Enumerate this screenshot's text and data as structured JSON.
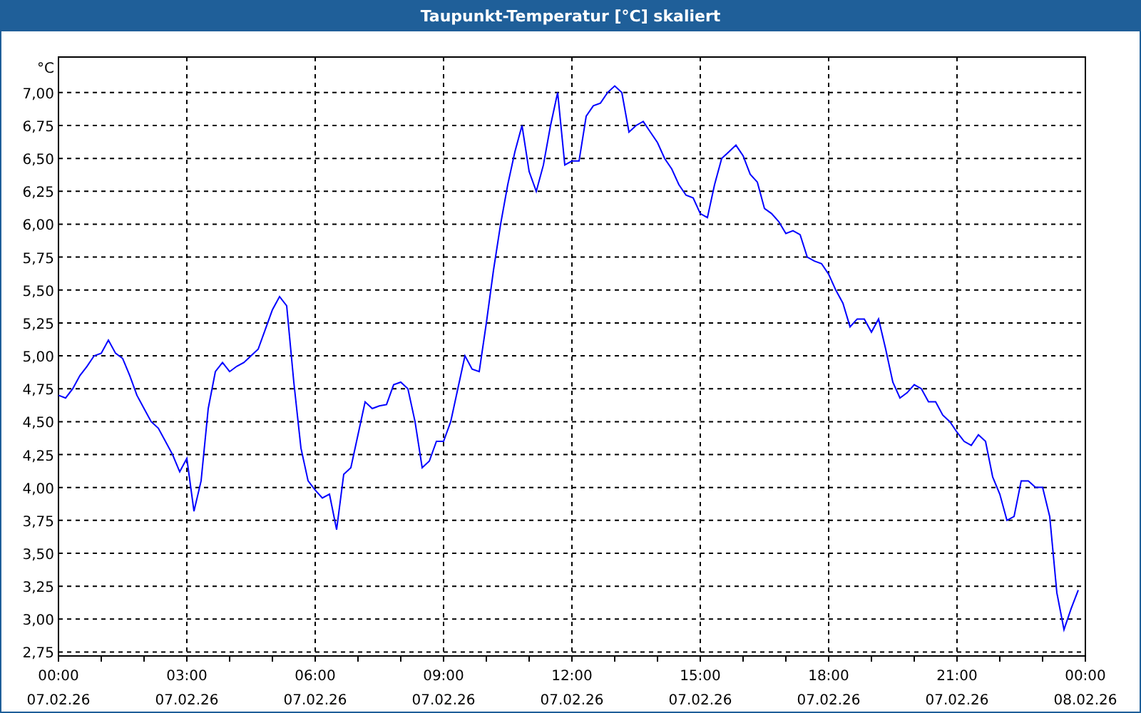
{
  "window": {
    "title": "Taupunkt-Temperatur [°C] skaliert"
  },
  "chart": {
    "chart_data": {
      "type": "line",
      "ylabel": "°C",
      "grid": true,
      "ylim": [
        2.72,
        7.27
      ],
      "categories": [
        "00:00 07.02.26",
        null,
        null,
        null,
        null,
        null,
        null,
        null,
        null,
        null,
        null,
        null,
        null,
        null,
        null,
        null,
        null,
        null,
        "03:00 07.02.26",
        null,
        null,
        null,
        null,
        null,
        null,
        null,
        null,
        null,
        null,
        null,
        null,
        null,
        null,
        null,
        null,
        null,
        "06:00 07.02.26",
        null,
        null,
        null,
        null,
        null,
        null,
        null,
        null,
        null,
        null,
        null,
        null,
        null,
        null,
        null,
        null,
        null,
        "09:00 07.02.26",
        null,
        null,
        null,
        null,
        null,
        null,
        null,
        null,
        null,
        null,
        null,
        null,
        null,
        null,
        null,
        null,
        null,
        "12:00 07.02.26",
        null,
        null,
        null,
        null,
        null,
        null,
        null,
        null,
        null,
        null,
        null,
        null,
        null,
        null,
        null,
        null,
        null,
        "15:00 07.02.26",
        null,
        null,
        null,
        null,
        null,
        null,
        null,
        null,
        null,
        null,
        null,
        null,
        null,
        null,
        null,
        null,
        null,
        "18:00 07.02.26",
        null,
        null,
        null,
        null,
        null,
        null,
        null,
        null,
        null,
        null,
        null,
        null,
        null,
        null,
        null,
        null,
        null,
        "21:00 07.02.26",
        null,
        null,
        null,
        null,
        null,
        null,
        null,
        null,
        null,
        null,
        null,
        null,
        null,
        null,
        null,
        null,
        null,
        "00:00 08.02.26"
      ],
      "yticks": [
        {
          "value": 2.75,
          "label": "2,75"
        },
        {
          "value": 3,
          "label": "3,00"
        },
        {
          "value": 3.25,
          "label": "3,25"
        },
        {
          "value": 3.5,
          "label": "3,50"
        },
        {
          "value": 3.75,
          "label": "3,75"
        },
        {
          "value": 4,
          "label": "4,00"
        },
        {
          "value": 4.25,
          "label": "4,25"
        },
        {
          "value": 4.5,
          "label": "4,50"
        },
        {
          "value": 4.75,
          "label": "4,75"
        },
        {
          "value": 5,
          "label": "5,00"
        },
        {
          "value": 5.25,
          "label": "5,25"
        },
        {
          "value": 5.5,
          "label": "5,50"
        },
        {
          "value": 5.75,
          "label": "5,75"
        },
        {
          "value": 6,
          "label": "6,00"
        },
        {
          "value": 6.25,
          "label": "6,25"
        },
        {
          "value": 6.5,
          "label": "6,50"
        },
        {
          "value": 6.75,
          "label": "6,75"
        },
        {
          "value": 7,
          "label": "7,00"
        }
      ],
      "series": [
        {
          "color": "#0000ff",
          "values": [
            4.7,
            4.68,
            4.75,
            4.85,
            4.92,
            5.0,
            5.02,
            5.12,
            5.02,
            4.98,
            4.85,
            4.7,
            4.6,
            4.5,
            4.45,
            4.35,
            4.25,
            4.12,
            4.22,
            3.82,
            4.05,
            4.6,
            4.88,
            4.95,
            4.88,
            4.92,
            4.95,
            5.0,
            5.05,
            5.2,
            5.35,
            5.45,
            5.38,
            4.8,
            4.3,
            4.05,
            3.98,
            3.92,
            3.95,
            3.68,
            4.1,
            4.15,
            4.4,
            4.65,
            4.6,
            4.62,
            4.63,
            4.78,
            4.8,
            4.75,
            4.5,
            4.15,
            4.2,
            4.35,
            4.35,
            4.5,
            4.75,
            5.0,
            4.9,
            4.88,
            5.25,
            5.65,
            6.0,
            6.3,
            6.55,
            6.75,
            6.4,
            6.25,
            6.45,
            6.75,
            7.0,
            6.45,
            6.48,
            6.48,
            6.82,
            6.9,
            6.92,
            7.0,
            7.05,
            7.0,
            6.7,
            6.75,
            6.78,
            6.7,
            6.62,
            6.5,
            6.42,
            6.3,
            6.22,
            6.2,
            6.08,
            6.05,
            6.3,
            6.5,
            6.55,
            6.6,
            6.52,
            6.38,
            6.32,
            6.12,
            6.08,
            6.02,
            5.93,
            5.95,
            5.92,
            5.75,
            5.72,
            5.7,
            5.62,
            5.5,
            5.4,
            5.22,
            5.28,
            5.28,
            5.18,
            5.28,
            5.05,
            4.8,
            4.68,
            4.72,
            4.78,
            4.75,
            4.65,
            4.65,
            4.55,
            4.5,
            4.42,
            4.35,
            4.32,
            4.4,
            4.35,
            4.08,
            3.95,
            3.75,
            3.78,
            4.05,
            4.05,
            4.0,
            4.0,
            3.78,
            3.2,
            2.92,
            3.08,
            3.22,
            null
          ]
        }
      ]
    }
  }
}
